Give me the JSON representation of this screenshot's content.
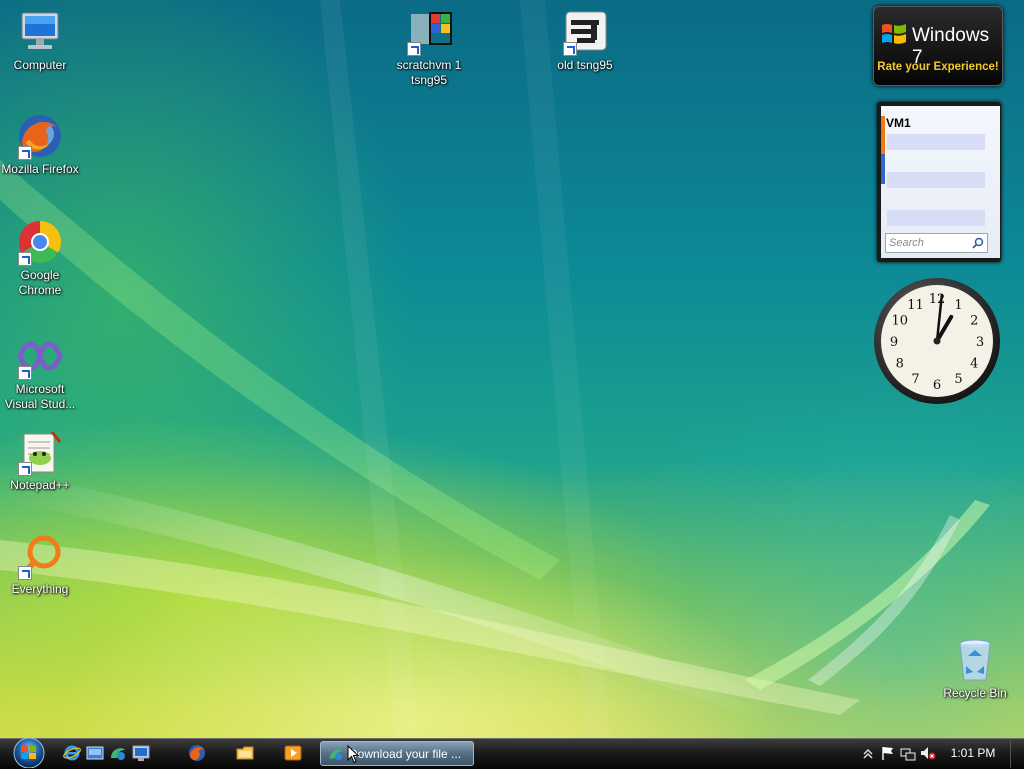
{
  "desktop": {
    "left_icons": [
      {
        "label": "Computer",
        "icon": "computer-icon"
      },
      {
        "label": "Mozilla Firefox",
        "icon": "firefox-icon"
      },
      {
        "label": "Google Chrome",
        "icon": "chrome-icon"
      },
      {
        "label": "Microsoft Visual Stud...",
        "icon": "visual-studio-icon"
      },
      {
        "label": "Notepad++",
        "icon": "notepad-plus-plus-icon"
      },
      {
        "label": "Everything",
        "icon": "everything-search-icon"
      }
    ],
    "top_icons": [
      {
        "label": "scratchvm 1 tsng95",
        "icon": "remote-desktop-windows-icon"
      },
      {
        "label": "old tsng95",
        "icon": "remote-desktop-icon"
      }
    ],
    "recycle_bin": {
      "label": "Recycle Bin",
      "icon": "recycle-bin-icon"
    }
  },
  "gadgets": {
    "windows7": {
      "title": "Windows 7",
      "subtitle": "Rate your Experience!"
    },
    "vm": {
      "title": "VM1",
      "search_placeholder": "Search"
    },
    "clock": {
      "numerals": [
        "12",
        "1",
        "2",
        "3",
        "4",
        "5",
        "6",
        "7",
        "8",
        "9",
        "10",
        "11"
      ],
      "hour": 1,
      "minute": 1
    }
  },
  "taskbar": {
    "quick_launch": [
      "internet-explorer-icon",
      "show-desktop-icon",
      "vmware-icon",
      "remote-desktop-icon"
    ],
    "pinned": [
      "firefox-icon",
      "windows-explorer-icon",
      "media-player-icon"
    ],
    "active_task": {
      "label": "Download your file ...",
      "icon": "vmware-icon"
    },
    "tray": [
      "show-hidden-icons-chevron",
      "action-center-flag-icon",
      "network-icon",
      "volume-muted-icon"
    ],
    "time": "1:01 PM"
  },
  "colors": {
    "accent_gold": "#f3c830",
    "taskbar": "#1c1c1c",
    "wallpaper_teal": "#0d8a96",
    "wallpaper_yellow": "#d8dd50"
  }
}
